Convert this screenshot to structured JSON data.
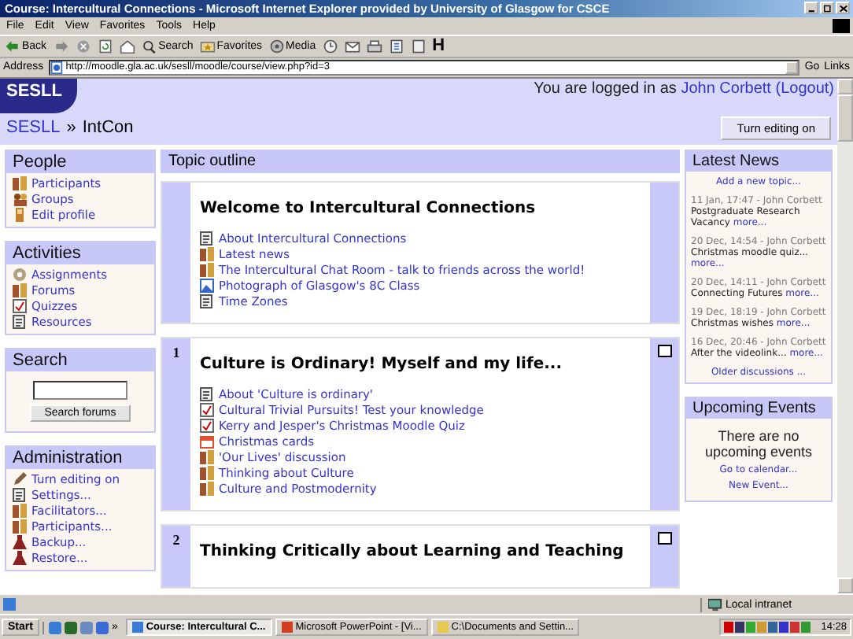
{
  "window": {
    "title": "Course: Intercultural Connections - Microsoft Internet Explorer provided by University of Glasgow for CSCE"
  },
  "menu": [
    "File",
    "Edit",
    "View",
    "Favorites",
    "Tools",
    "Help"
  ],
  "toolbar": [
    {
      "kind": "back",
      "label": "Back"
    },
    {
      "kind": "forward"
    },
    {
      "kind": "stop"
    },
    {
      "kind": "refresh"
    },
    {
      "kind": "home"
    },
    {
      "kind": "search",
      "label": "Search"
    },
    {
      "kind": "favorites",
      "label": "Favorites"
    },
    {
      "kind": "media",
      "label": "Media"
    },
    {
      "kind": "history"
    },
    {
      "kind": "mail"
    },
    {
      "kind": "print"
    },
    {
      "kind": "edit"
    },
    {
      "kind": "discuss"
    },
    {
      "kind": "letter",
      "label": "H"
    }
  ],
  "address": {
    "label": "Address",
    "value": "http://moodle.gla.ac.uk/sesll/moodle/course/view.php?id=3",
    "go": "Go",
    "links": "Links"
  },
  "header": {
    "logo": "SESLL",
    "login_prefix": "You are logged in as",
    "user": "John Corbett",
    "logout": "(Logout)",
    "breadcrumb": {
      "home": "SESLL",
      "separator": "»",
      "current": "IntCon"
    },
    "edit_button": "Turn editing on"
  },
  "left_blocks": [
    {
      "kind": "list",
      "title": "People",
      "items": [
        {
          "kind": "people",
          "label": "Participants"
        },
        {
          "kind": "groups",
          "label": "Groups"
        },
        {
          "kind": "profile",
          "label": "Edit profile"
        }
      ]
    },
    {
      "kind": "list",
      "title": "Activities",
      "items": [
        {
          "kind": "assignment",
          "label": "Assignments"
        },
        {
          "kind": "people",
          "label": "Forums"
        },
        {
          "kind": "quiz",
          "label": "Quizzes"
        },
        {
          "kind": "document",
          "label": "Resources"
        }
      ]
    },
    {
      "kind": "search",
      "title": "Search",
      "button": "Search forums"
    },
    {
      "kind": "list",
      "title": "Administration",
      "items": [
        {
          "kind": "edit",
          "label": "Turn editing on"
        },
        {
          "kind": "document",
          "label": "Settings..."
        },
        {
          "kind": "people",
          "label": "Facilitators..."
        },
        {
          "kind": "people",
          "label": "Participants..."
        },
        {
          "kind": "backup",
          "label": "Backup..."
        },
        {
          "kind": "backup",
          "label": "Restore..."
        }
      ]
    }
  ],
  "topic_outline": {
    "title": "Topic outline",
    "sections": [
      {
        "title": "Welcome to Intercultural Connections",
        "items": [
          {
            "kind": "document",
            "label": "About Intercultural Connections"
          },
          {
            "kind": "people",
            "label": "Latest news"
          },
          {
            "kind": "people",
            "label": "The Intercultural Chat Room - talk to friends across the world!"
          },
          {
            "kind": "image",
            "label": "Photograph of Glasgow's 8C Class"
          },
          {
            "kind": "document",
            "label": "Time Zones"
          }
        ]
      },
      {
        "number": "1",
        "title": "Culture is Ordinary! Myself and my life...",
        "items": [
          {
            "kind": "document",
            "label": "About 'Culture is ordinary'"
          },
          {
            "kind": "quiz",
            "label": "Cultural Trivial Pursuits! Test your knowledge"
          },
          {
            "kind": "quiz",
            "label": "Kerry and Jesper's Christmas Moodle Quiz"
          },
          {
            "kind": "cards",
            "label": "Christmas cards"
          },
          {
            "kind": "people",
            "label": "'Our Lives' discussion"
          },
          {
            "kind": "people",
            "label": "Thinking about Culture"
          },
          {
            "kind": "people",
            "label": "Culture and Postmodernity"
          }
        ]
      },
      {
        "number": "2",
        "title": "Thinking Critically about Learning and Teaching"
      }
    ]
  },
  "latest_news": {
    "title": "Latest News",
    "add": "Add a new topic...",
    "posts": [
      {
        "meta": "11 Jan, 17:47 - John Corbett",
        "text": "Postgraduate Research Vacancy",
        "more": "more..."
      },
      {
        "meta": "20 Dec, 14:54 - John Corbett",
        "text": "Christmas moodle quiz...",
        "more": "more..."
      },
      {
        "meta": "20 Dec, 14:11 - John Corbett",
        "text": "Connecting Futures",
        "more": "more..."
      },
      {
        "meta": "19 Dec, 18:19 - John Corbett",
        "text": "Christmas wishes",
        "more": "more..."
      },
      {
        "meta": "16 Dec, 20:46 - John Corbett",
        "text": "After the videolink...",
        "more": "more..."
      }
    ],
    "older": "Older discussions ..."
  },
  "upcoming_events": {
    "title": "Upcoming Events",
    "text": "There are no upcoming events",
    "links": [
      "Go to calendar...",
      "New Event..."
    ]
  },
  "status_bar": {
    "zone": "Local intranet"
  },
  "taskbar": {
    "start": "Start",
    "more": "»",
    "tasks": [
      {
        "label": "Course: Intercultural C...",
        "selected": true,
        "kind": "browser"
      },
      {
        "label": "Microsoft PowerPoint - [Vi...",
        "selected": false,
        "kind": "slides"
      },
      {
        "label": "C:\\Documents and Settin...",
        "selected": false,
        "kind": "folder"
      }
    ],
    "clock": "14:28"
  }
}
